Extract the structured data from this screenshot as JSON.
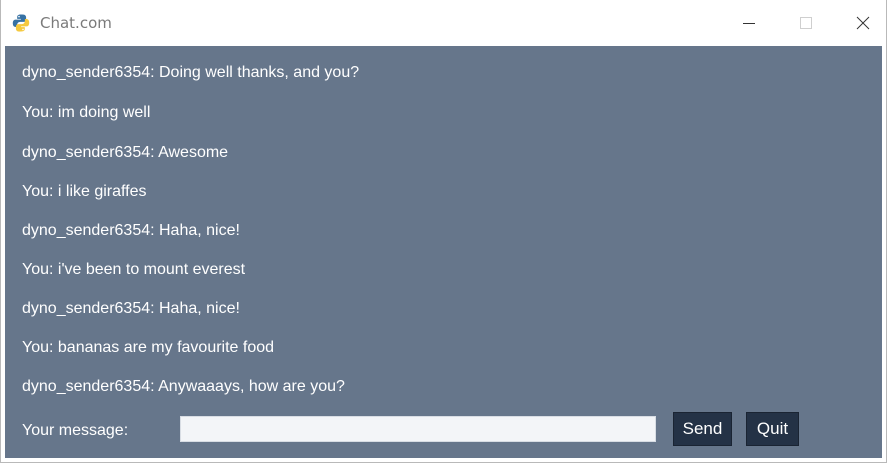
{
  "window": {
    "title": "Chat.com",
    "icon": "python-logo-icon",
    "controls": [
      "minimize-icon",
      "maximize-icon",
      "close-icon"
    ]
  },
  "chat": {
    "messages": [
      "dyno_sender6354: Doing well thanks, and you?",
      "You: im doing well",
      "dyno_sender6354: Awesome",
      "You: i like giraffes",
      "dyno_sender6354: Haha, nice!",
      "You: i've been to mount everest",
      "dyno_sender6354: Haha, nice!",
      "You: bananas are my favourite food",
      "dyno_sender6354: Anywaaays, how are you?"
    ]
  },
  "composer": {
    "label": "Your message:",
    "value": "",
    "send_label": "Send",
    "quit_label": "Quit"
  },
  "colors": {
    "chat_background": "#66768b",
    "button_background": "#243246",
    "text": "#ffffff"
  }
}
